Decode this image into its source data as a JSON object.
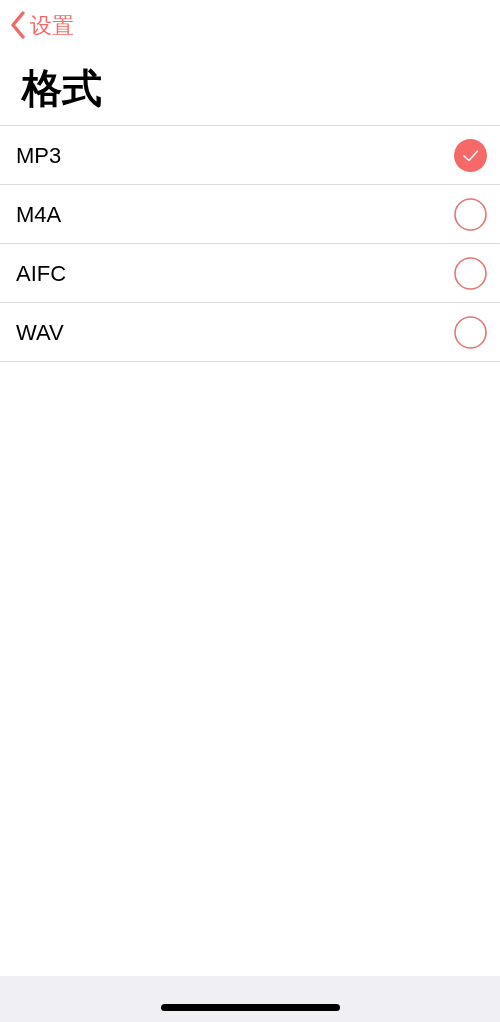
{
  "nav": {
    "back_label": "设置"
  },
  "title": "格式",
  "options": [
    {
      "label": "MP3",
      "selected": true
    },
    {
      "label": "M4A",
      "selected": false
    },
    {
      "label": "AIFC",
      "selected": false
    },
    {
      "label": "WAV",
      "selected": false
    }
  ]
}
